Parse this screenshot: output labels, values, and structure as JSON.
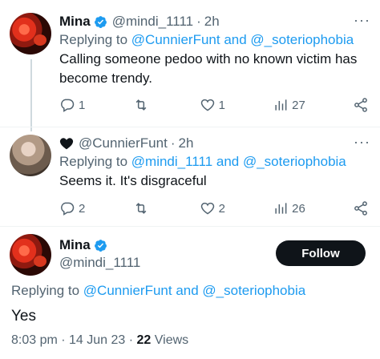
{
  "tweets": [
    {
      "name": "Mina",
      "handle": "@mindi_1111",
      "dot": "·",
      "time": "2h",
      "reply_prefix": "Replying to ",
      "reply_user_1": "@CunnierFunt",
      "reply_and": " and ",
      "reply_user_2": "@_soteriophobia",
      "text": "Calling someone pedoo with no known victim has become trendy.",
      "replies": "1",
      "retweets": "",
      "likes": "1",
      "views": "27",
      "verified": true
    },
    {
      "name": "",
      "handle": "@CunnierFunt",
      "dot": "·",
      "time": "2h",
      "reply_prefix": "Replying to ",
      "reply_user_1": "@mindi_1111",
      "reply_and": " and ",
      "reply_user_2": "@_soteriophobia",
      "text": "Seems it. It's disgraceful",
      "replies": "2",
      "retweets": "",
      "likes": "2",
      "views": "26",
      "badge_icon": "black-heart-icon"
    }
  ],
  "main": {
    "name": "Mina",
    "handle": "@mindi_1111",
    "follow_label": "Follow",
    "reply_prefix": "Replying to ",
    "reply_user_1": "@CunnierFunt",
    "reply_and": " and ",
    "reply_user_2": "@_soteriophobia",
    "text": "Yes",
    "time": "8:03 pm",
    "sep1": " · ",
    "date": "14 Jun 23",
    "sep2": " · ",
    "views_count": "22",
    "views_label": " Views"
  },
  "colors": {
    "link": "#1d9bf0",
    "muted": "#536471",
    "text": "#0f1419",
    "verified": "#1d9bf0"
  }
}
